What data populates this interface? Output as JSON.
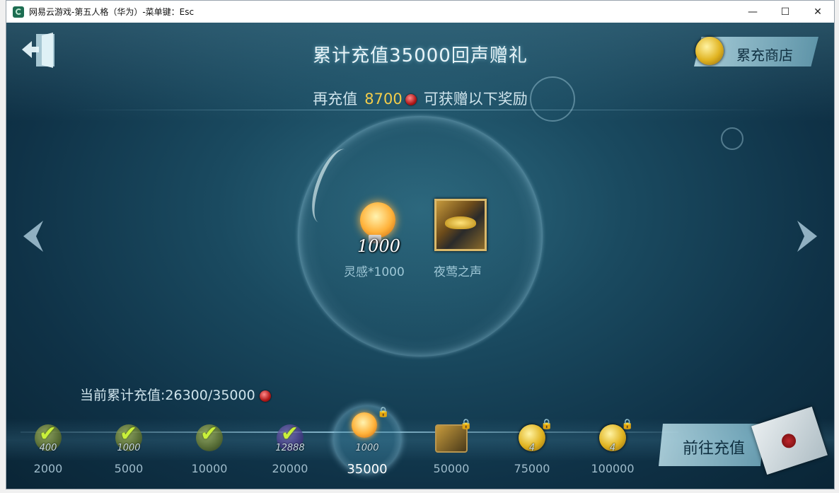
{
  "window": {
    "title": "网易云游戏-第五人格（华为）-菜单键：Esc",
    "controls": {
      "minimize": "—",
      "maximize": "☐",
      "close": "✕"
    }
  },
  "header": {
    "title": "累计充值35000回声赠礼",
    "shop_label": "累充商店",
    "subline_prefix": "再充值",
    "subline_amount": "8700",
    "subline_suffix": "可获赠以下奖励"
  },
  "rewards": [
    {
      "icon": "inspiration-bulb-icon",
      "qty": "1000",
      "label": "灵感*1000"
    },
    {
      "icon": "nightingale-portrait-icon",
      "label": "夜莺之声"
    }
  ],
  "progress": {
    "text": "当前累计充值:26300/35000"
  },
  "milestones": [
    {
      "label": "2000",
      "qty": "400",
      "state": "claimed"
    },
    {
      "label": "5000",
      "qty": "1000",
      "state": "claimed"
    },
    {
      "label": "10000",
      "qty": "",
      "state": "claimed"
    },
    {
      "label": "20000",
      "qty": "12888",
      "state": "claimed"
    },
    {
      "label": "35000",
      "qty": "1000",
      "state": "current"
    },
    {
      "label": "50000",
      "qty": "",
      "state": "locked"
    },
    {
      "label": "75000",
      "qty": "4",
      "state": "locked"
    },
    {
      "label": "100000",
      "qty": "4",
      "state": "locked"
    }
  ],
  "actions": {
    "recharge_label": "前往充值"
  },
  "colors": {
    "accent_gold": "#f2cc4a",
    "title_text": "#e8f4f8",
    "gem_red": "#b01818"
  }
}
